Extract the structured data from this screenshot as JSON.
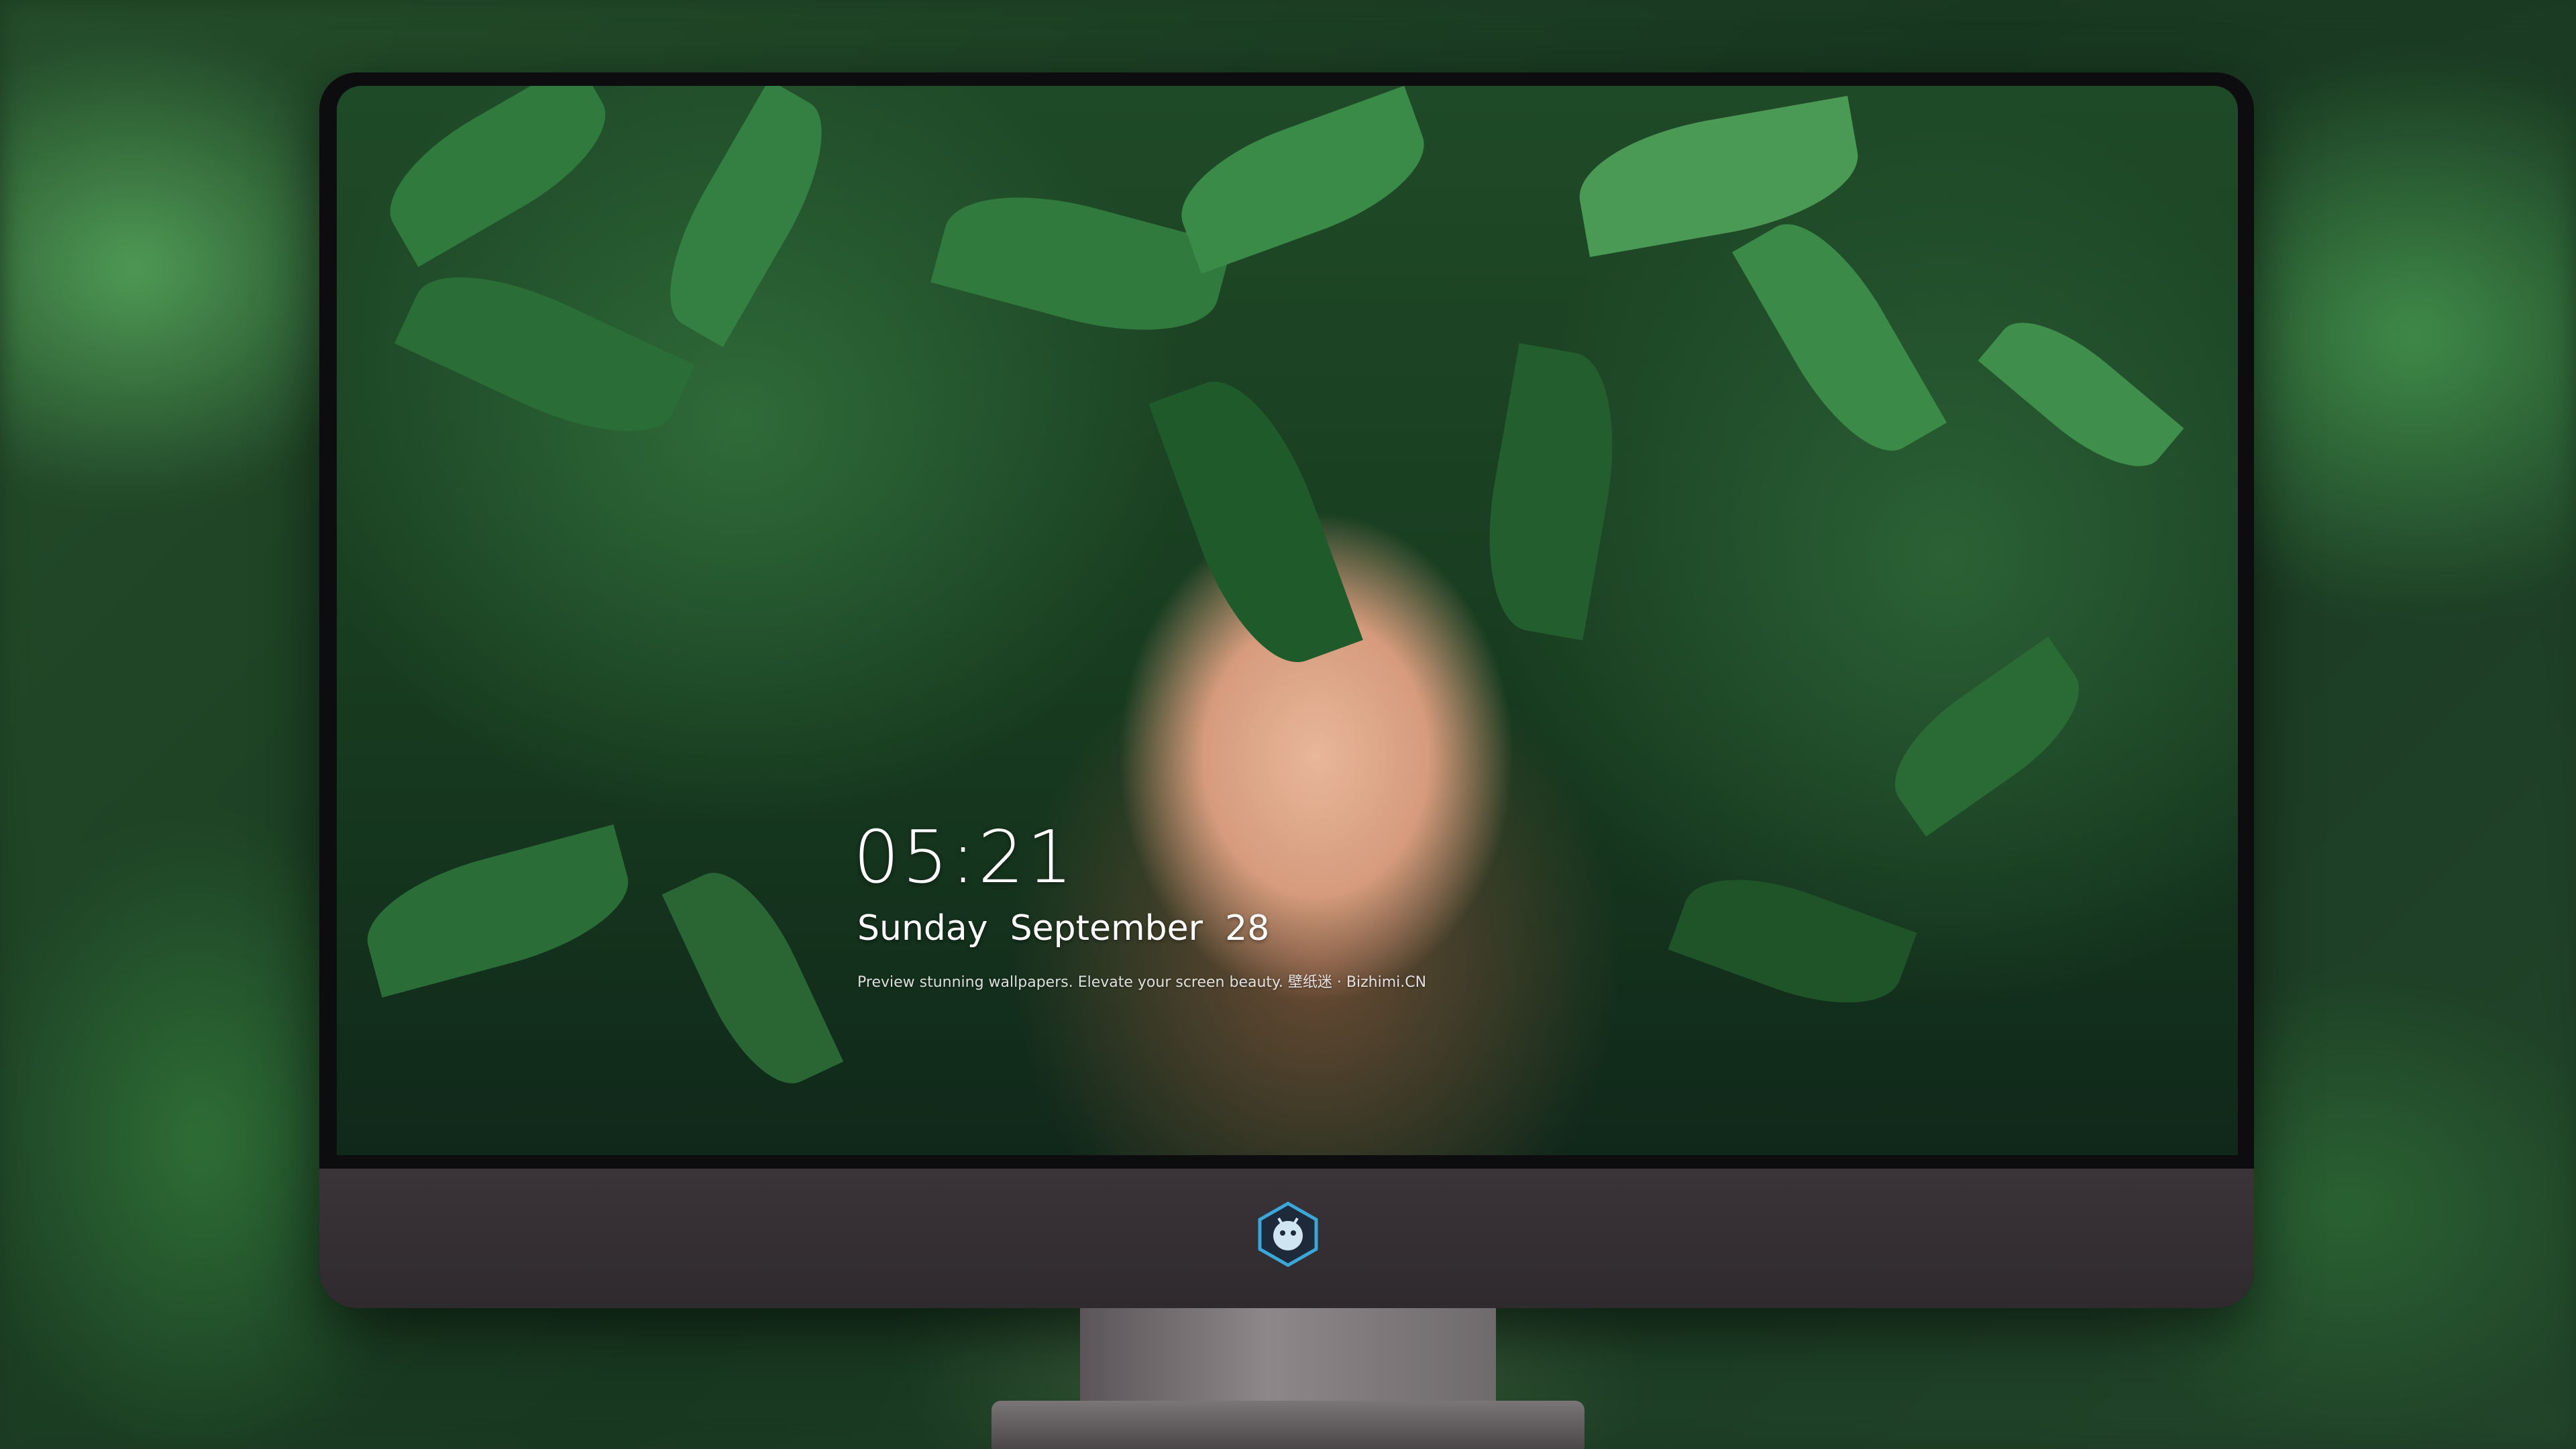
{
  "lockscreen": {
    "time": "05:21",
    "date": "Sunday  September  28",
    "tagline": "Preview stunning wallpapers. Elevate your screen beauty. 壁纸迷 · Bizhimi.CN"
  },
  "dock": {
    "apps": [
      {
        "icon": "messages-icon",
        "glyph": "💬",
        "color": "#3ec95a"
      },
      {
        "icon": "weather-icon",
        "glyph": "☁",
        "color": "#3a8fe8"
      },
      {
        "icon": "clock-icon",
        "glyph": "🕐",
        "color": "#f2f2f2"
      },
      {
        "icon": "preview-icon",
        "glyph": "🖼",
        "color": "#d9b64a"
      },
      {
        "icon": "clapper-icon",
        "glyph": "🎬",
        "color": "#37b6d8"
      },
      {
        "icon": "notes-icon",
        "glyph": "▤",
        "color": "#f6d24a"
      },
      {
        "icon": "photos-icon",
        "glyph": "▦",
        "color": "#5aa0e0"
      },
      {
        "icon": "music-icon",
        "glyph": "♫",
        "color": "#e55bd0"
      },
      {
        "icon": "app-store-icon",
        "glyph": "Ⓐ",
        "color": "#2a7ff0"
      },
      {
        "icon": "camera-icon",
        "glyph": "◉",
        "color": "#5a5a5a"
      }
    ]
  },
  "brand": {
    "logo": "dragon-mascot-logo",
    "accent": "#3aa7d8"
  },
  "colors": {
    "chin": "#332e32",
    "bezel": "#0d0d0f"
  }
}
